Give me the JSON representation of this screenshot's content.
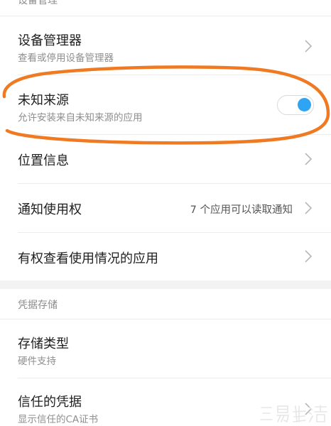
{
  "sections": {
    "device_management_header": "设备管理",
    "credential_storage_header": "凭据存储"
  },
  "rows": {
    "device_manager": {
      "title": "设备管理器",
      "subtitle": "查看或停用设备管理器"
    },
    "unknown_sources": {
      "title": "未知来源",
      "subtitle": "允许安装来自未知来源的应用",
      "toggle_state": "on"
    },
    "location": {
      "title": "位置信息"
    },
    "notification_access": {
      "title": "通知使用权",
      "value": "7 个应用可以读取通知"
    },
    "usage_access": {
      "title": "有权查看使用情况的应用"
    },
    "storage_type": {
      "title": "存储类型",
      "subtitle": "硬件支持"
    },
    "trusted_credentials": {
      "title": "信任的凭据",
      "subtitle": "显示信任的CA证书"
    }
  },
  "watermark": {
    "text": "三易生活"
  },
  "colors": {
    "accent": "#2fa4f2",
    "annotation": "#f07a22",
    "section_gap": "#f3f3f3"
  },
  "icons": {
    "chevron": "chevron-right-icon"
  }
}
